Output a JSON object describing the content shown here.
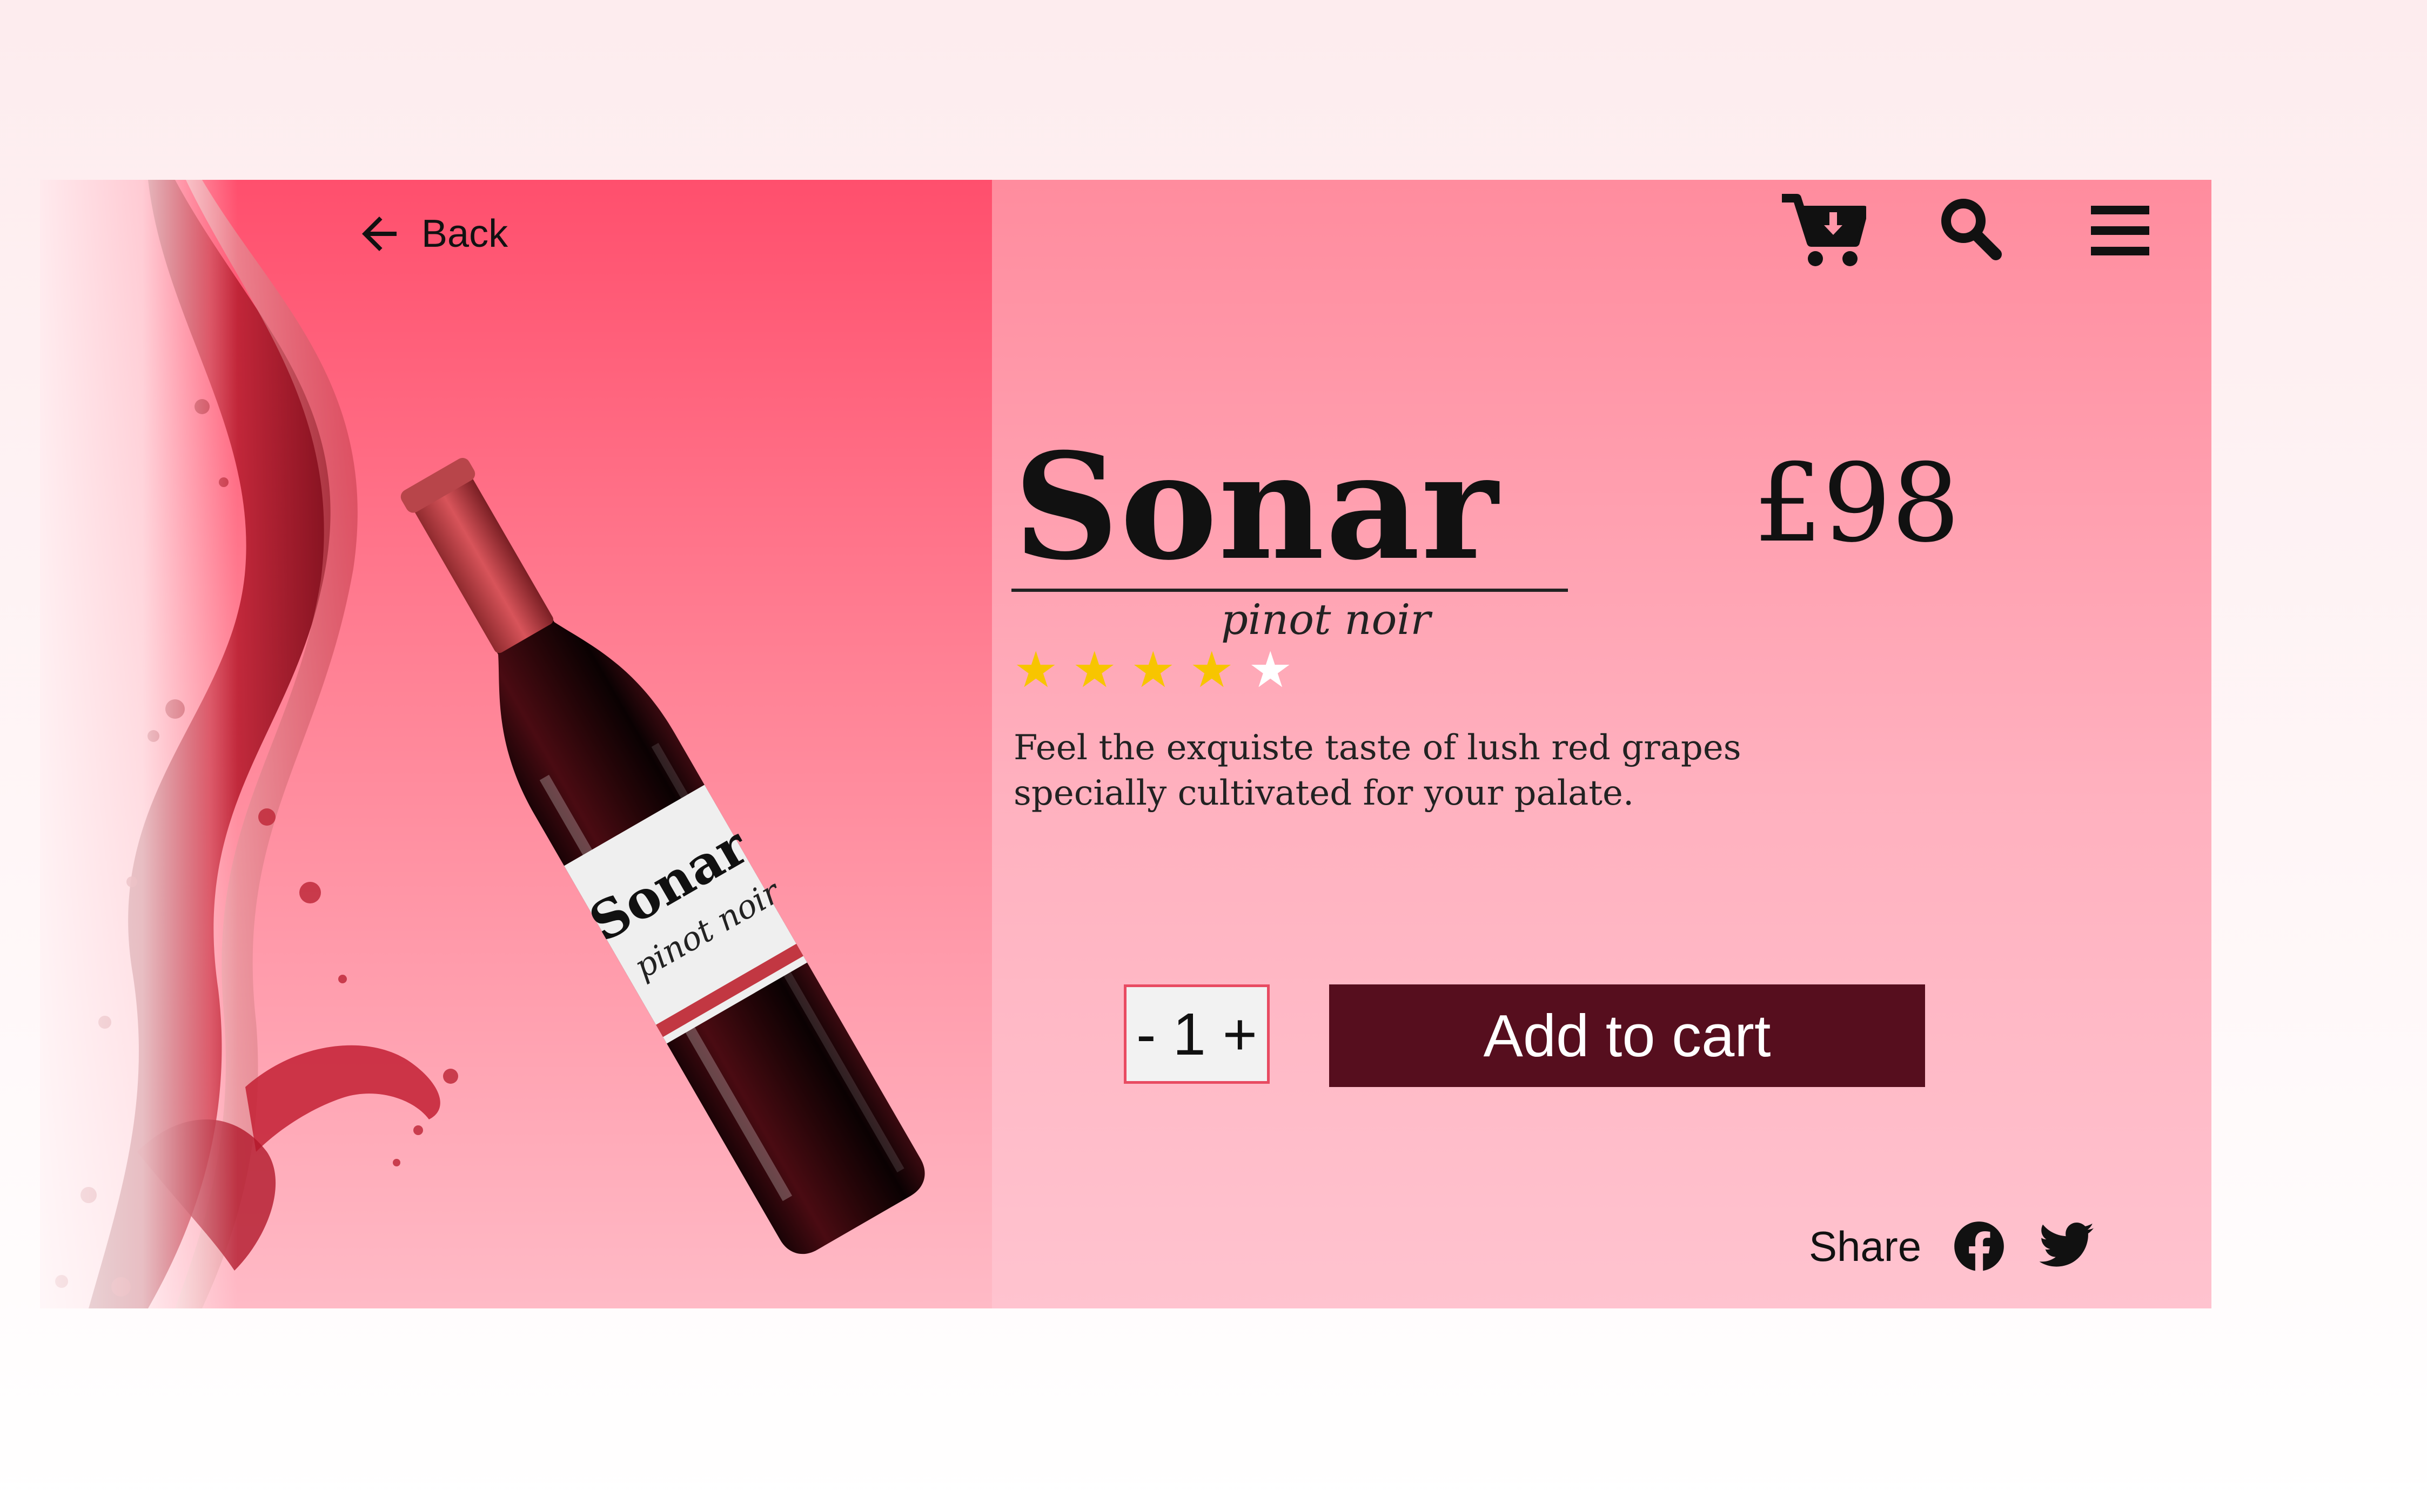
{
  "nav": {
    "back_label": "Back"
  },
  "header_icons": [
    "cart-icon",
    "search-icon",
    "menu-icon"
  ],
  "product": {
    "name": "Sonar",
    "variety": "pinot noir",
    "price": "£98",
    "rating": 4,
    "rating_max": 5,
    "description": "Feel the exquiste taste of lush red grapes specially cultivated for your palate.",
    "label_name": "Sonar",
    "label_variety": "pinot noir"
  },
  "quantity": {
    "minus": "-",
    "value": "1",
    "plus": "+"
  },
  "actions": {
    "add_to_cart": "Add to cart"
  },
  "share": {
    "label": "Share",
    "networks": [
      "facebook-icon",
      "twitter-icon"
    ]
  },
  "colors": {
    "accent_button": "#560e1e",
    "star_filled": "#f7c500",
    "star_empty": "#ffffff",
    "panel_left_top": "#ff4f6d",
    "panel_right_top": "#ff8c9e"
  }
}
